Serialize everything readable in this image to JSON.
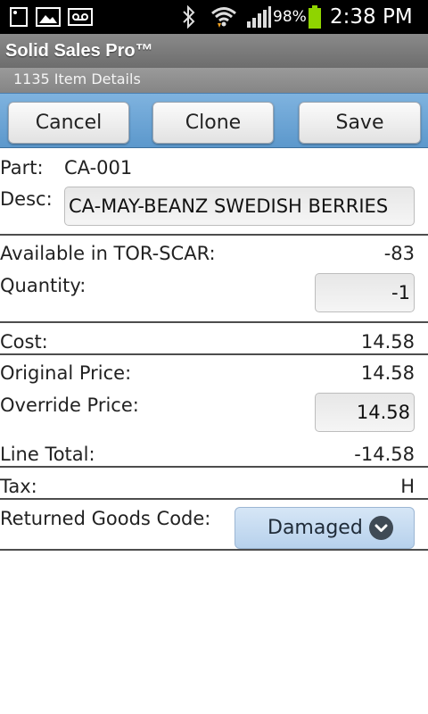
{
  "status_bar": {
    "battery_percent": "98%",
    "time": "2:38 PM",
    "icons": [
      "picture-icon",
      "voicemail-icon",
      "bluetooth-icon",
      "wifi-icon",
      "signal-icon",
      "battery-icon"
    ]
  },
  "app": {
    "title": "Solid Sales Pro™",
    "subtitle": "1135 Item Details"
  },
  "toolbar": {
    "cancel_label": "Cancel",
    "clone_label": "Clone",
    "save_label": "Save"
  },
  "form": {
    "part_label": "Part:",
    "part_value": "CA-001",
    "desc_label": "Desc:",
    "desc_value": "CA-MAY-BEANZ SWEDISH BERRIES",
    "available_label": "Available in TOR-SCAR:",
    "available_value": "-83",
    "quantity_label": "Quantity:",
    "quantity_value": "-1",
    "cost_label": "Cost:",
    "cost_value": "14.58",
    "original_price_label": "Original Price:",
    "original_price_value": "14.58",
    "override_price_label": "Override Price:",
    "override_price_value": "14.58",
    "line_total_label": "Line Total:",
    "line_total_value": "-14.58",
    "tax_label": "Tax:",
    "tax_value": "H",
    "returned_goods_label": "Returned Goods Code:",
    "returned_goods_value": "Damaged"
  },
  "colors": {
    "toolbar_blue": "#6fa6d6",
    "select_blue": "#c5dbf1",
    "battery_green": "#8fd400"
  }
}
